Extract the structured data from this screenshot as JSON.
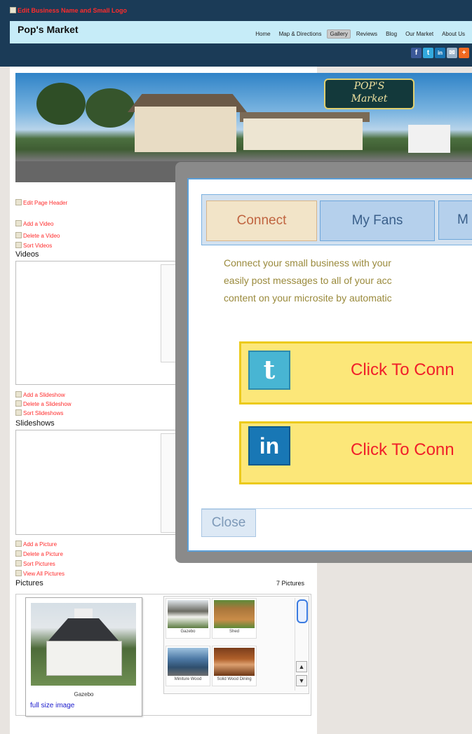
{
  "header": {
    "edit_business": "Edit Business Name and Small Logo",
    "site_name": "Pop's Market",
    "nav": [
      "Home",
      "Map & Directions",
      "Gallery",
      "Reviews",
      "Blog",
      "Our Market",
      "About Us"
    ],
    "active_nav": "Gallery",
    "social": [
      "f",
      "t",
      "in",
      "✉",
      "+"
    ]
  },
  "hero": {
    "sign_line1": "POP'S",
    "sign_line2": "Market"
  },
  "content": {
    "edit_page_header": "Edit Page Header",
    "video_links": [
      "Add a Video",
      "Delete a Video",
      "Sort Videos"
    ],
    "videos_label": "Videos",
    "slideshow_links": [
      "Add a Slideshow",
      "Delete a Slideshow",
      "Sort Slideshows"
    ],
    "slideshows_label": "Slideshows",
    "picture_links": [
      "Add a Picture",
      "Delete a Picture",
      "Sort Pictures",
      "View All Pictures"
    ],
    "pictures_label": "Pictures",
    "pictures_count": "7 Pictures",
    "featured_caption": "Gazebo",
    "full_size_link": "full size image",
    "thumbnails": [
      "Gazebo",
      "Shed",
      "Miniture Wood",
      "Solid Wood Dining"
    ]
  },
  "modal": {
    "tabs": [
      "Connect",
      "My Fans",
      "M"
    ],
    "text_lines": [
      "Connect your small business with your",
      "easily post messages to all of your acc",
      "content on your microsite by automatic"
    ],
    "twitter_icon": "t",
    "linkedin_icon": "in",
    "twitter_label": "Click To Conn",
    "linkedin_label": "Click To Conn",
    "close_label": "Close"
  },
  "colors": {
    "header_bg": "#1b3b57",
    "name_bar": "#c6ecf8",
    "edit_link": "#ff2b2b",
    "connect_box": "#fce779",
    "connect_text": "#f0202a"
  }
}
